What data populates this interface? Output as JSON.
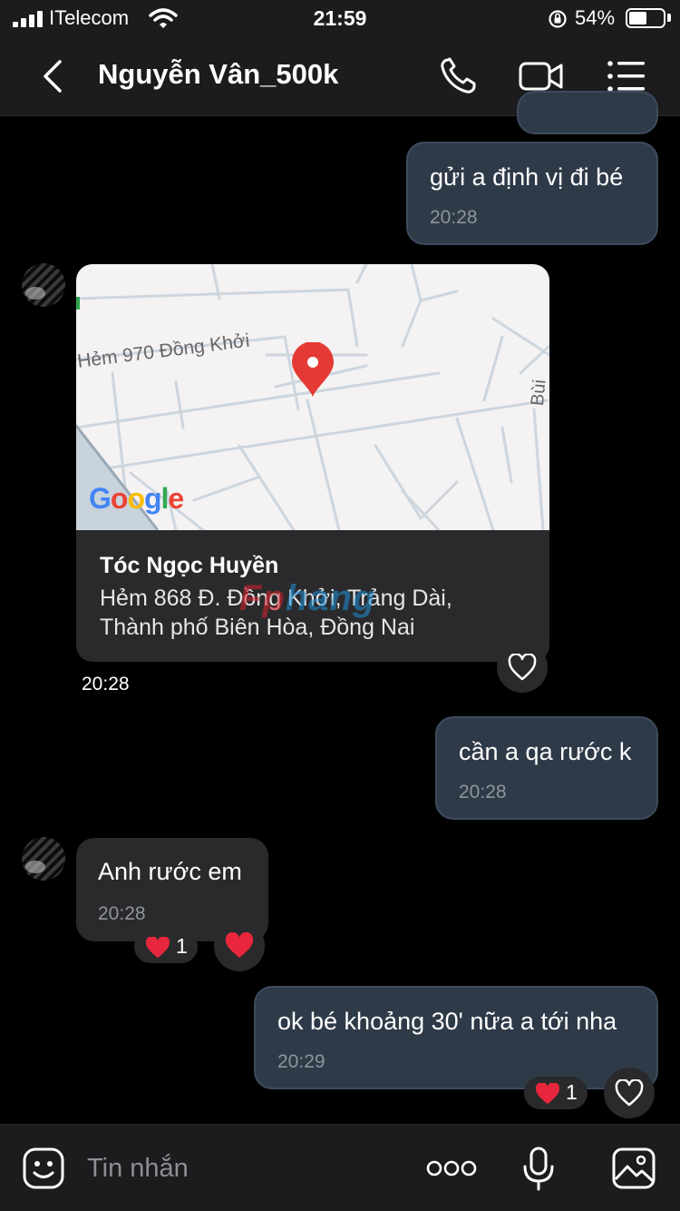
{
  "status_bar": {
    "carrier": "ITelecom",
    "time": "21:59",
    "battery_percent": "54%",
    "battery_level": 0.54
  },
  "header": {
    "contact_name": "Nguyễn Vân_500k",
    "icons": [
      "back-chevron-icon",
      "phone-icon",
      "video-camera-icon",
      "menu-list-icon"
    ]
  },
  "messages": [
    {
      "direction": "out",
      "text": "gửi a định vị đi bé",
      "time": "20:28"
    },
    {
      "direction": "in",
      "type": "location",
      "map_label": "Hẻm 970 Đồng Khởi",
      "map_brand": "Google",
      "place_name": "Tóc Ngọc Huyền",
      "address_line1": "Hẻm 868 Đ. Đồng Khởi, Trảng Dài,",
      "address_line2": "Thành phố Biên Hòa, Đồng Nai",
      "time": "20:28"
    },
    {
      "direction": "out",
      "text": "cần a qa rước k",
      "time": "20:28"
    },
    {
      "direction": "in",
      "text": "Anh rước em",
      "time": "20:28",
      "reaction_count": "1"
    },
    {
      "direction": "out",
      "text": "ok bé khoảng 30' nữa a tới nha",
      "time": "20:29",
      "reaction_count": "1"
    }
  ],
  "watermark": {
    "part_a": "Fp",
    "part_b": "hang"
  },
  "composer": {
    "placeholder": "Tin nhắn",
    "icons": [
      "emoji-icon",
      "more-options-icon",
      "microphone-icon",
      "image-icon"
    ]
  },
  "colors": {
    "background": "#000000",
    "bar": "#1c1c1e",
    "outgoing_bubble": "#2f3a48",
    "incoming_bubble": "#2a2a2c",
    "heart": "#e8273c",
    "map_pin": "#e53935"
  }
}
